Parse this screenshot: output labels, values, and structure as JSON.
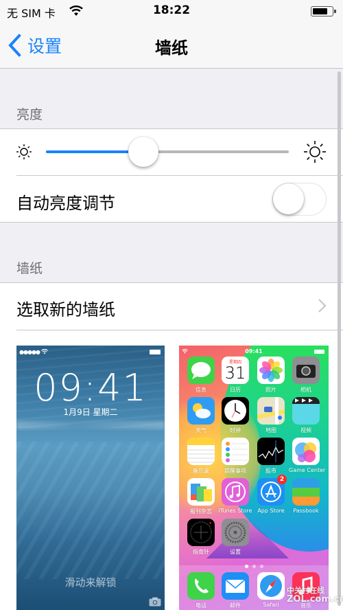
{
  "status_bar": {
    "carrier": "无 SIM 卡",
    "time": "18:22",
    "battery_level": 0.8,
    "icons": [
      "wifi-icon",
      "battery-icon"
    ]
  },
  "nav": {
    "back_label": "设置",
    "title": "墙纸",
    "back_icon": "chevron-left-icon"
  },
  "brightness": {
    "section_header": "亮度",
    "slider_value": 0.4,
    "min_icon": "sun-small-icon",
    "max_icon": "sun-large-icon",
    "auto_label": "自动亮度调节",
    "auto_enabled": false
  },
  "wallpaper": {
    "section_header": "墙纸",
    "choose_label": "选取新的墙纸",
    "chevron_icon": "chevron-right-icon"
  },
  "lock_preview": {
    "time": "09:41",
    "date": "1月9日 星期二",
    "unlock_hint": "滑动来解锁",
    "signal": "●●●●●"
  },
  "home_preview": {
    "time": "09:41",
    "calendar_weekday": "星期四",
    "calendar_day": "31",
    "apps": [
      {
        "label": "信息",
        "icon": "messages-icon",
        "color": "#3fd34a"
      },
      {
        "label": "日历",
        "icon": "calendar-icon",
        "color": "#ffffff"
      },
      {
        "label": "照片",
        "icon": "photos-icon",
        "color": "#ffffff"
      },
      {
        "label": "相机",
        "icon": "camera-icon",
        "color": "#8e8e93"
      },
      {
        "label": "天气",
        "icon": "weather-icon",
        "color": "#2f9cf3"
      },
      {
        "label": "时钟",
        "icon": "clock-icon",
        "color": "#000000"
      },
      {
        "label": "地图",
        "icon": "maps-icon",
        "color": "#e8e3c9"
      },
      {
        "label": "视频",
        "icon": "videos-icon",
        "color": "#5ad8e8"
      },
      {
        "label": "备忘录",
        "icon": "notes-icon",
        "color": "#ffffff"
      },
      {
        "label": "提醒事项",
        "icon": "reminders-icon",
        "color": "#ffffff"
      },
      {
        "label": "股市",
        "icon": "stocks-icon",
        "color": "#000000"
      },
      {
        "label": "Game Center",
        "icon": "game-center-icon",
        "color": "#ffffff"
      },
      {
        "label": "报刊杂志",
        "icon": "newsstand-icon",
        "color": "#ffffff"
      },
      {
        "label": "iTunes Store",
        "icon": "itunes-store-icon",
        "color": "#e35fd8"
      },
      {
        "label": "App Store",
        "icon": "app-store-icon",
        "color": "#1e8ff5",
        "badge": "2"
      },
      {
        "label": "Passbook",
        "icon": "passbook-icon",
        "color": "#2d9fe6"
      },
      {
        "label": "指南针",
        "icon": "compass-icon",
        "color": "#000000"
      },
      {
        "label": "设置",
        "icon": "settings-icon",
        "color": "#8e8e93"
      }
    ],
    "dock": [
      {
        "label": "电话",
        "icon": "phone-icon",
        "color": "#3fd34a"
      },
      {
        "label": "邮件",
        "icon": "mail-icon",
        "color": "#1e8ff5"
      },
      {
        "label": "Safari",
        "icon": "safari-icon",
        "color": "#ffffff"
      },
      {
        "label": "音乐",
        "icon": "music-icon",
        "color": "#fc3158"
      }
    ],
    "page_count": 3,
    "current_page": 0
  },
  "watermark": {
    "line1": "中关村在线",
    "line2": "ZOL.com.cn"
  },
  "colors": {
    "accent": "#1a82fb",
    "group_bg": "#efeff4",
    "separator": "#c8c7cc",
    "header_text": "#6d6d72"
  }
}
